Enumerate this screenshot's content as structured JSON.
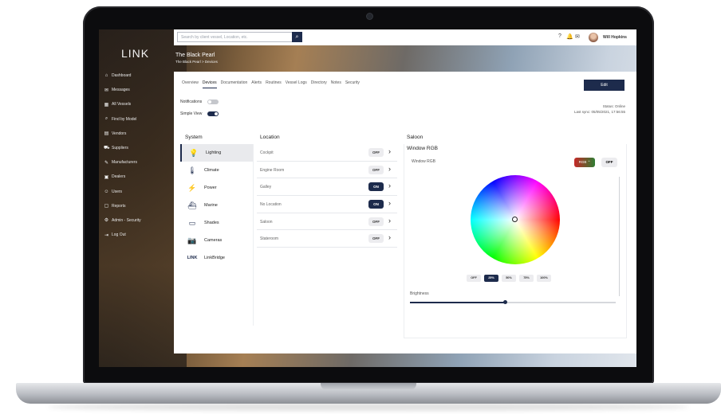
{
  "app": {
    "brand": "LINK"
  },
  "sidebar": {
    "items": [
      {
        "icon": "dashboard-icon",
        "glyph": "⌂",
        "label": "Dashboard"
      },
      {
        "icon": "messages-icon",
        "glyph": "✉",
        "label": "Messages"
      },
      {
        "icon": "vessels-icon",
        "glyph": "▦",
        "label": "All Vessels"
      },
      {
        "icon": "find-by-model-icon",
        "glyph": "⌕",
        "label": "Find by Model"
      },
      {
        "icon": "vendors-icon",
        "glyph": "▤",
        "label": "Vendors"
      },
      {
        "icon": "suppliers-icon",
        "glyph": "⛟",
        "label": "Suppliers"
      },
      {
        "icon": "manufacturers-icon",
        "glyph": "✎",
        "label": "Manufacturers"
      },
      {
        "icon": "dealers-icon",
        "glyph": "▣",
        "label": "Dealers"
      },
      {
        "icon": "users-icon",
        "glyph": "☺",
        "label": "Users"
      },
      {
        "icon": "reports-icon",
        "glyph": "▢",
        "label": "Reports"
      },
      {
        "icon": "admin-security-icon",
        "glyph": "⚙",
        "label": "Admin - Security"
      },
      {
        "icon": "logout-icon",
        "glyph": "⇥",
        "label": "Log Out"
      }
    ]
  },
  "topbar": {
    "search_placeholder": "Search by client vessel, Location, etc.",
    "user_name": "Will Hopkins"
  },
  "vessel": {
    "title": "The Black Pearl",
    "breadcrumb": "The Black Pearl > Devices"
  },
  "tabs": [
    {
      "label": "Overview"
    },
    {
      "label": "Devices",
      "active": true
    },
    {
      "label": "Documentation"
    },
    {
      "label": "Alerts"
    },
    {
      "label": "Routines"
    },
    {
      "label": "Vessel Logs"
    },
    {
      "label": "Directory"
    },
    {
      "label": "Notes"
    },
    {
      "label": "Security"
    }
  ],
  "edit_label": "Edit",
  "status": {
    "line1": "Status: Online",
    "line2": "Last sync: 05/05/2021, 17:56:55"
  },
  "toggles": {
    "notifications": {
      "label": "Notifications",
      "on": false
    },
    "simple_view": {
      "label": "Simple View",
      "on": true
    }
  },
  "headers": {
    "system": "System",
    "location": "Location",
    "saloon": "Saloon",
    "window_rgb": "Window RGB"
  },
  "systems": [
    {
      "icon": "lighting-icon",
      "glyph": "💡",
      "label": "Lighting",
      "active": true
    },
    {
      "icon": "climate-icon",
      "glyph": "🌡",
      "label": "Climate"
    },
    {
      "icon": "power-icon",
      "glyph": "⚡",
      "label": "Power"
    },
    {
      "icon": "marine-icon",
      "glyph": "⛴",
      "label": "Marine"
    },
    {
      "icon": "shades-icon",
      "glyph": "▭",
      "label": "Shades"
    },
    {
      "icon": "cameras-icon",
      "glyph": "📷",
      "label": "Cameras"
    },
    {
      "icon": "link-icon",
      "glyph": "LINK",
      "label": "LinkBridge"
    }
  ],
  "locations": [
    {
      "name": "Cockpit",
      "state": "OFF"
    },
    {
      "name": "Engine Room",
      "state": "OFF"
    },
    {
      "name": "Galley",
      "state": "ON"
    },
    {
      "name": "No Location",
      "state": "ON"
    },
    {
      "name": "Saloon",
      "state": "OFF"
    },
    {
      "name": "Stateroom",
      "state": "OFF"
    }
  ],
  "rgb": {
    "label": "Window RGB",
    "mode_label": "RGB ⌃",
    "off_label": "OFF",
    "presets": [
      "OFF",
      "25%",
      "50%",
      "75%",
      "100%"
    ],
    "active_preset": "25%",
    "brightness_label": "Brightness",
    "brightness_fraction": 0.46
  },
  "colors": {
    "accent": "#1d2b4c"
  }
}
